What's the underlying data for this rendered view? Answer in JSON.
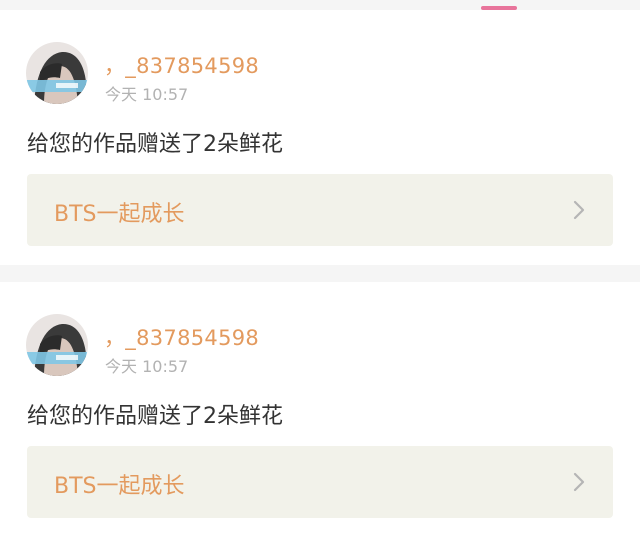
{
  "colors": {
    "accent_pink": "#e8749b",
    "username_orange": "#e39a5e",
    "link_background": "#f2f2ea",
    "divider_gray": "#f5f5f5"
  },
  "notifications": [
    {
      "username": "，_837854598",
      "timestamp": "今天 10:57",
      "message": "给您的作品赠送了2朵鲜花",
      "work_title": "BTS一起成长",
      "icon": "chevron-right-icon"
    },
    {
      "username": "，_837854598",
      "timestamp": "今天 10:57",
      "message": "给您的作品赠送了2朵鲜花",
      "work_title": "BTS一起成长",
      "icon": "chevron-right-icon"
    }
  ]
}
